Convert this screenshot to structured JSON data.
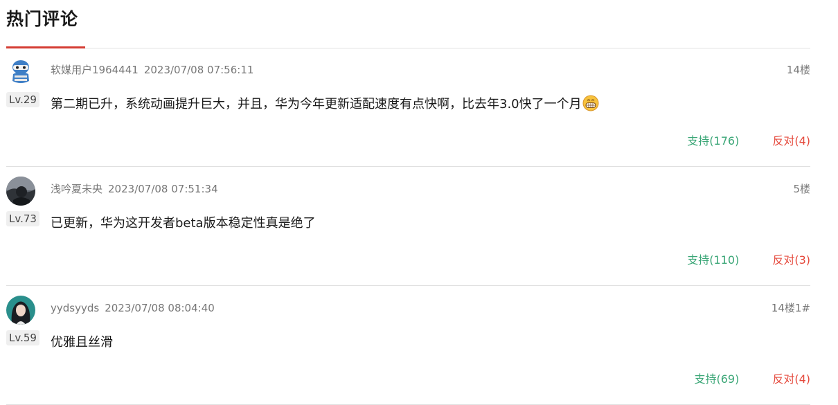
{
  "section": {
    "title": "热门评论"
  },
  "colors": {
    "accent_underline": "#d43c33",
    "support": "#3aa676",
    "oppose": "#e5483b"
  },
  "comments": [
    {
      "avatar_icon": "mascot-avatar",
      "level": "Lv.29",
      "username": "软媒用户1964441",
      "timestamp": "2023/07/08 07:56:11",
      "floor": "14楼",
      "text": "第二期已升，系统动画提升巨大，并且，华为今年更新适配速度有点快啊，比去年3.0快了一个月",
      "emoji": "grinning-emoji",
      "support_label": "支持(176)",
      "oppose_label": "反对(4)"
    },
    {
      "avatar_icon": "dark-photo-avatar",
      "level": "Lv.73",
      "username": "浅吟夏未央",
      "timestamp": "2023/07/08 07:51:34",
      "floor": "5楼",
      "text": "已更新，华为这开发者beta版本稳定性真是绝了",
      "support_label": "支持(110)",
      "oppose_label": "反对(3)"
    },
    {
      "avatar_icon": "portrait-avatar",
      "level": "Lv.59",
      "username": "yydsyyds",
      "timestamp": "2023/07/08 08:04:40",
      "floor": "14楼1#",
      "text": "优雅且丝滑",
      "support_label": "支持(69)",
      "oppose_label": "反对(4)"
    }
  ]
}
